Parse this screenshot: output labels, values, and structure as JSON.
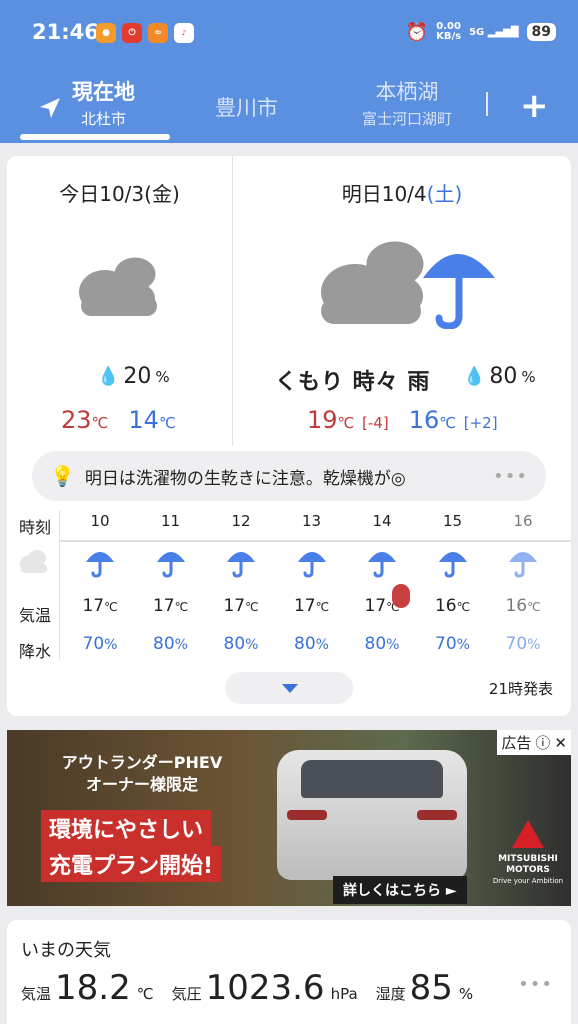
{
  "status_bar": {
    "time": "21:46",
    "net_speed_value": "0.00",
    "net_speed_unit": "KB/s",
    "signal": "5G",
    "battery": "89"
  },
  "tabs": {
    "active": {
      "label": "現在地",
      "sub": "北杜市"
    },
    "second": {
      "label": "豊川市"
    },
    "third": {
      "label": "本栖湖",
      "sub": "富士河口湖町"
    }
  },
  "today": {
    "title_prefix": "今日10/3(",
    "dow": "金",
    "title_suffix": ")",
    "precip": "20",
    "precip_unit": "%",
    "high": "23",
    "low": "14",
    "unit": "℃"
  },
  "tomorrow": {
    "title_prefix": "明日10/4",
    "dow_part": "(土)",
    "description": "くもり 時々 雨",
    "precip": "80",
    "precip_unit": "%",
    "high": "19",
    "high_diff": "[-4]",
    "low": "16",
    "low_diff": "[+2]",
    "unit": "℃"
  },
  "tip": {
    "text": "明日は洗濯物の生乾きに注意。乾燥機が◎",
    "more": "•••"
  },
  "hourly": {
    "labels": {
      "time": "時刻",
      "temp": "気温",
      "precip": "降水"
    },
    "hours": [
      {
        "hour": "10",
        "temp": "17",
        "precip": "70"
      },
      {
        "hour": "11",
        "temp": "17",
        "precip": "80"
      },
      {
        "hour": "12",
        "temp": "17",
        "precip": "80"
      },
      {
        "hour": "13",
        "temp": "17",
        "precip": "80"
      },
      {
        "hour": "14",
        "temp": "17",
        "precip": "80"
      },
      {
        "hour": "15",
        "temp": "16",
        "precip": "70"
      },
      {
        "hour": "16",
        "temp": "16",
        "precip": "70"
      }
    ],
    "temp_unit": "℃",
    "precip_unit": "%",
    "issued": "21時発表"
  },
  "ad": {
    "label": "広告",
    "headline1": "アウトランダーPHEV",
    "headline2": "オーナー様限定",
    "line1": "環境にやさしい",
    "line2": "充電プラン開始!",
    "cta": "詳しくはこちら ►",
    "brand1": "MITSUBISHI",
    "brand2": "MOTORS",
    "brand3": "Drive your Ambition"
  },
  "now": {
    "title": "いまの天気",
    "temp_label": "気温",
    "temp": "18.2",
    "temp_unit": "℃",
    "pressure_label": "気圧",
    "pressure": "1023.6",
    "pressure_unit": "hPa",
    "humidity_label": "湿度",
    "humidity": "85",
    "humidity_unit": "%",
    "more": "•••"
  },
  "colors": {
    "header": "#5b8fe0",
    "high": "#c23b3b",
    "low": "#3b72d9",
    "umbrella": "#4a7ee8"
  }
}
